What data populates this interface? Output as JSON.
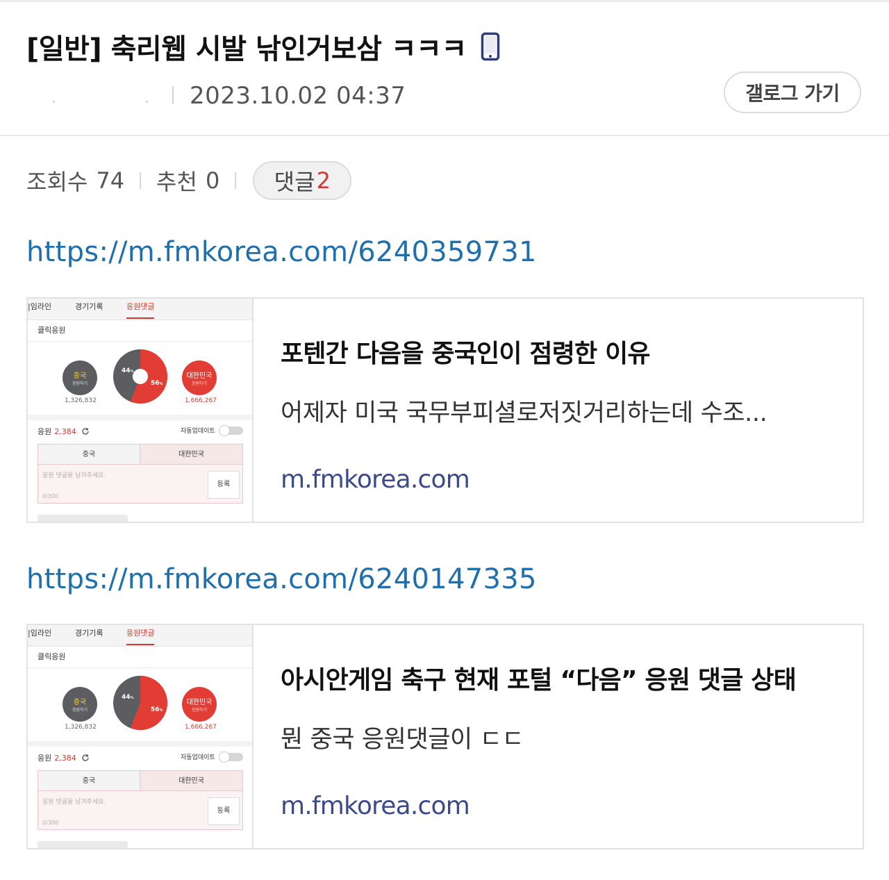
{
  "post": {
    "title": "[일반] 축리웹 시발 낚인거보삼 ㅋㅋㅋ",
    "date": "2023.10.02 04:37",
    "gallery_button": "갤로그 가기",
    "device_icon": "mobile-phone-icon"
  },
  "stats": {
    "views_label": "조회수",
    "views": "74",
    "recommend_label": "추천",
    "recommend": "0",
    "comments_label": "댓글",
    "comments": "2"
  },
  "links": [
    {
      "url": "https://m.fmkorea.com/6240359731",
      "card": {
        "title": "포텐간 다음을 중국인이 점령한 이유",
        "description": "어제자 미국 국무부피셜로저짓거리하는데 수조...",
        "domain": "m.fmkorea.com"
      }
    },
    {
      "url": "https://m.fmkorea.com/6240147335",
      "card": {
        "title": "아시안게임 축구 현재 포털 “다음” 응원 댓글 상태",
        "description": "뭔 중국 응원댓글이 ㄷㄷ",
        "domain": "m.fmkorea.com"
      }
    }
  ],
  "thumbnail": {
    "tabs": [
      "|임라인",
      "경기기록",
      "응원댓글"
    ],
    "click_cheer": "클릭응원",
    "china_label": "중국",
    "china_sub": "응원하기",
    "korea_label": "대한민국",
    "korea_sub": "응원하기",
    "china_percent": "44",
    "korea_percent": "56",
    "percent_unit": "%",
    "china_count": "1,326,832",
    "korea_count": "1,666,267",
    "cheer_label": "응원",
    "cheer_count": "2,384",
    "auto_update": "자동업데이트",
    "comment_tab_china": "중국",
    "comment_tab_korea": "대한민국",
    "comment_placeholder": "응원 댓글을 남겨주세요.",
    "comment_counter": "0/300",
    "submit_label": "등록"
  },
  "colors": {
    "link": "#1e6fae",
    "accent_red": "#d23a2f",
    "domain": "#3b4a8a",
    "china_gray": "#5b5d61",
    "korea_red": "#e23d35"
  }
}
